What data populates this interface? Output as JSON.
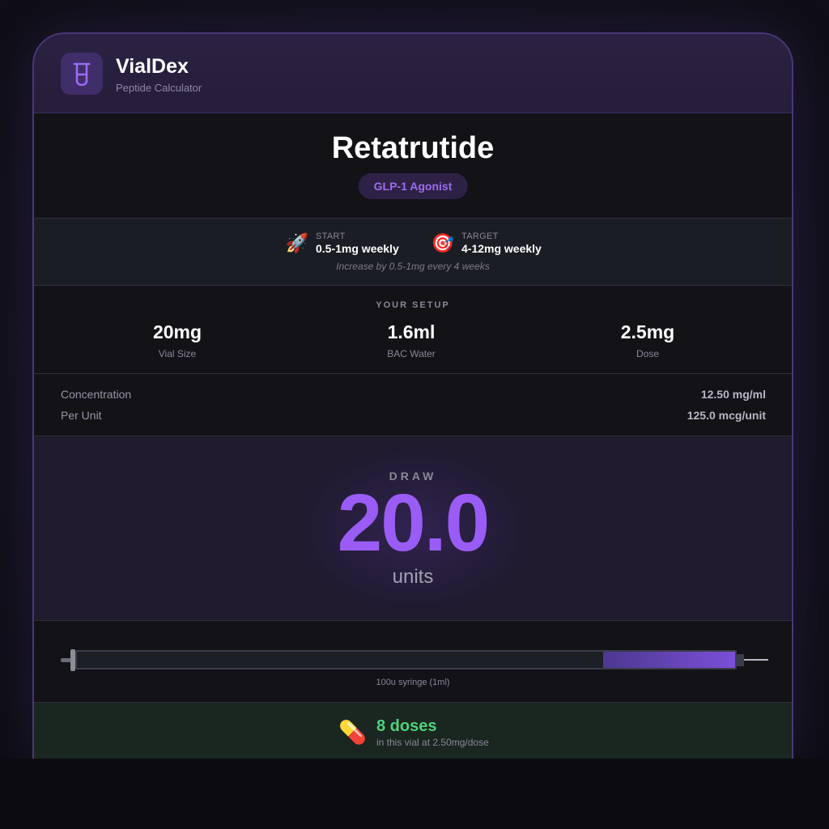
{
  "app": {
    "title": "VialDex",
    "subtitle": "Peptide Calculator",
    "logo_icon": "vial-icon"
  },
  "peptide": {
    "name": "Retatrutide",
    "category": "GLP-1 Agonist"
  },
  "protocol": {
    "start": {
      "icon": "rocket-icon",
      "glyph": "🚀",
      "label": "START",
      "value": "0.5-1mg weekly"
    },
    "target": {
      "icon": "target-icon",
      "glyph": "🎯",
      "label": "TARGET",
      "value": "4-12mg weekly"
    },
    "note": "Increase by 0.5-1mg every 4 weeks"
  },
  "setup": {
    "title": "YOUR SETUP",
    "stats": [
      {
        "value": "20mg",
        "label": "Vial Size"
      },
      {
        "value": "1.6ml",
        "label": "BAC Water"
      },
      {
        "value": "2.5mg",
        "label": "Dose"
      }
    ]
  },
  "concentration": {
    "rows": [
      {
        "label": "Concentration",
        "value": "12.50 mg/ml"
      },
      {
        "label": "Per Unit",
        "value": "125.0 mcg/unit"
      }
    ]
  },
  "draw": {
    "label": "DRAW",
    "value": "20.0",
    "unit": "units"
  },
  "syringe": {
    "label": "100u syringe (1ml)",
    "fill_fraction": 0.2
  },
  "doses": {
    "icon": "pill-icon",
    "glyph": "💊",
    "count": "8 doses",
    "subtitle": "in this vial at 2.50mg/dose"
  },
  "colors": {
    "accent": "#9a5cf5",
    "badge_text": "#9c6cf0",
    "success": "#4ed37a",
    "card_border": "#4a3878"
  }
}
